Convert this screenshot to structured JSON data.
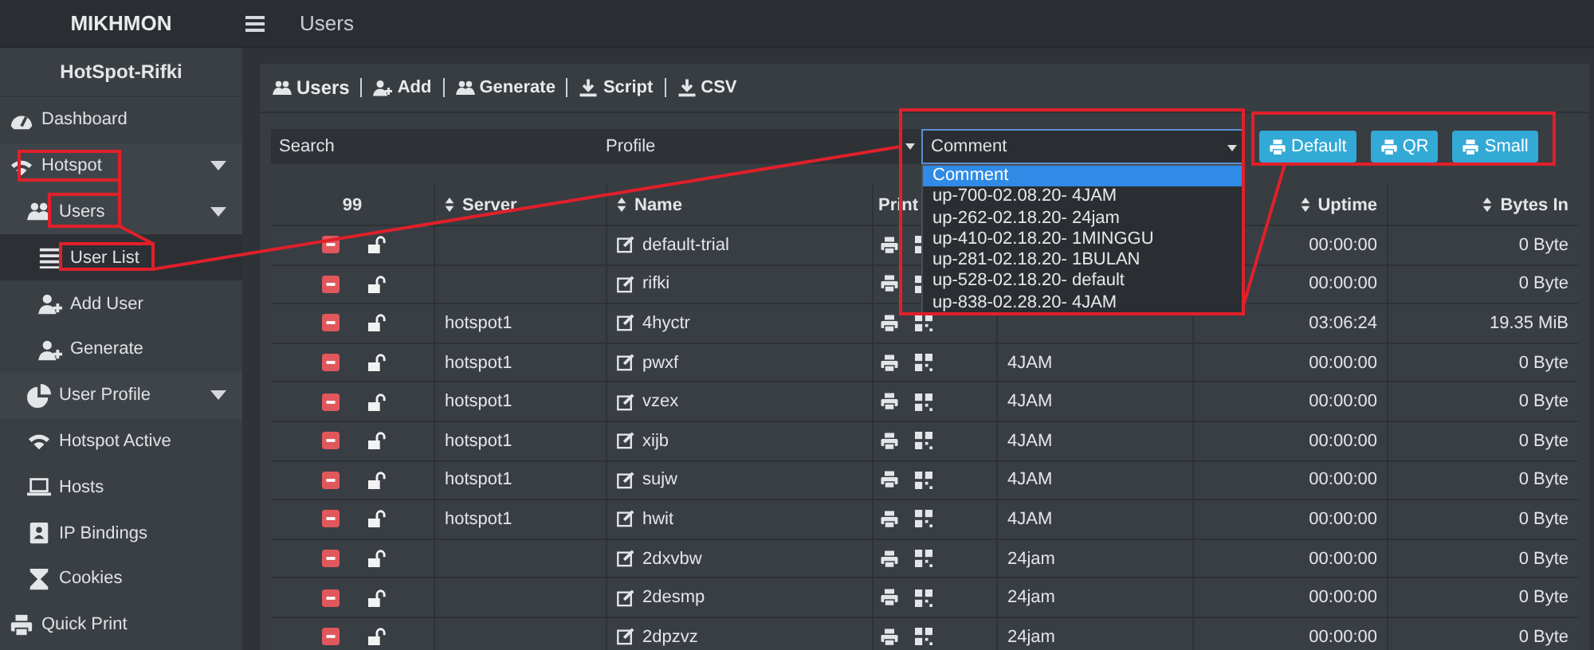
{
  "topbar": {
    "brand": "MIKHMON",
    "title": "Users"
  },
  "sidebar": {
    "title": "HotSpot-Rifki",
    "items": [
      {
        "label": "Dashboard",
        "kind": "link",
        "selected": false
      },
      {
        "label": "Hotspot",
        "kind": "submenu",
        "selected": false,
        "children": [
          {
            "label": "Users",
            "kind": "submenu",
            "selected": false,
            "children": [
              {
                "label": "User List",
                "kind": "link",
                "selected": true
              },
              {
                "label": "Add User",
                "kind": "link",
                "selected": false
              },
              {
                "label": "Generate",
                "kind": "link",
                "selected": false
              }
            ]
          },
          {
            "label": "User Profile",
            "kind": "submenu",
            "selected": false
          },
          {
            "label": "Hotspot Active",
            "kind": "link",
            "selected": false
          },
          {
            "label": "Hosts",
            "kind": "link",
            "selected": false
          },
          {
            "label": "IP Bindings",
            "kind": "link",
            "selected": false
          },
          {
            "label": "Cookies",
            "kind": "link",
            "selected": false
          }
        ]
      },
      {
        "label": "Quick Print",
        "kind": "link",
        "selected": false
      }
    ]
  },
  "card_links": [
    "Users",
    "Add",
    "Generate",
    "Script",
    "CSV"
  ],
  "filters": {
    "search": {
      "placeholder": "Search"
    },
    "profile": {
      "value": "Profile"
    },
    "comment": {
      "value": "Comment",
      "options": [
        {
          "label": "Comment",
          "selected": true
        },
        {
          "label": "up-700-02.08.20- 4JAM",
          "selected": false
        },
        {
          "label": "up-262-02.18.20- 24jam",
          "selected": false
        },
        {
          "label": "up-410-02.18.20- 1MINGGU",
          "selected": false
        },
        {
          "label": "up-281-02.18.20- 1BULAN",
          "selected": false
        },
        {
          "label": "up-528-02.18.20- default",
          "selected": false
        },
        {
          "label": "up-838-02.28.20- 4JAM",
          "selected": false
        }
      ]
    }
  },
  "print_buttons": [
    "Default",
    "QR",
    "Small"
  ],
  "table": {
    "columns": [
      {
        "label": "99",
        "sortable": false
      },
      {
        "label": "Server",
        "sortable": true
      },
      {
        "label": "Name",
        "sortable": true
      },
      {
        "label": "Print",
        "sortable": false
      },
      {
        "label": "Uptime",
        "sortable": true
      },
      {
        "label": "Bytes In",
        "sortable": true
      }
    ],
    "rows": [
      {
        "server": "",
        "name": "default-trial",
        "profile": "",
        "uptime": "00:00:00",
        "bytes_in": "0 Byte"
      },
      {
        "server": "",
        "name": "rifki",
        "profile": "",
        "uptime": "00:00:00",
        "bytes_in": "0 Byte"
      },
      {
        "server": "hotspot1",
        "name": "4hyctr",
        "profile": "",
        "uptime": "03:06:24",
        "bytes_in": "19.35 MiB"
      },
      {
        "server": "hotspot1",
        "name": "pwxf",
        "profile": "4JAM",
        "uptime": "00:00:00",
        "bytes_in": "0 Byte"
      },
      {
        "server": "hotspot1",
        "name": "vzex",
        "profile": "4JAM",
        "uptime": "00:00:00",
        "bytes_in": "0 Byte"
      },
      {
        "server": "hotspot1",
        "name": "xijb",
        "profile": "4JAM",
        "uptime": "00:00:00",
        "bytes_in": "0 Byte"
      },
      {
        "server": "hotspot1",
        "name": "sujw",
        "profile": "4JAM",
        "uptime": "00:00:00",
        "bytes_in": "0 Byte"
      },
      {
        "server": "hotspot1",
        "name": "hwit",
        "profile": "4JAM",
        "uptime": "00:00:00",
        "bytes_in": "0 Byte"
      },
      {
        "server": "",
        "name": "2dxvbw",
        "profile": "24jam",
        "uptime": "00:00:00",
        "bytes_in": "0 Byte"
      },
      {
        "server": "",
        "name": "2desmp",
        "profile": "24jam",
        "uptime": "00:00:00",
        "bytes_in": "0 Byte"
      },
      {
        "server": "",
        "name": "2dpzvz",
        "profile": "24jam",
        "uptime": "00:00:00",
        "bytes_in": "0 Byte"
      }
    ]
  },
  "annotated": true
}
